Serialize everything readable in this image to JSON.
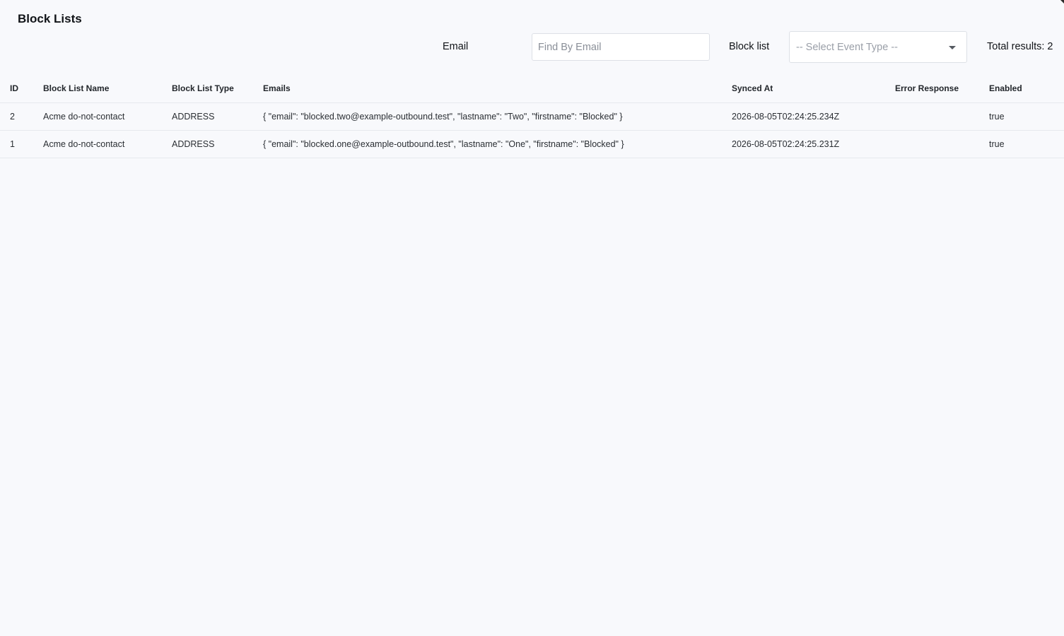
{
  "page": {
    "title": "Block Lists"
  },
  "filters": {
    "email_label": "Email",
    "email_placeholder": "Find By Email",
    "email_value": "",
    "blocklist_label": "Block list",
    "blocklist_selected": "-- Select Event Type --",
    "total_results": "Total results: 2"
  },
  "table": {
    "columns": {
      "id": "ID",
      "name": "Block List Name",
      "type": "Block List Type",
      "emails": "Emails",
      "synced_at": "Synced At",
      "error_response": "Error Response",
      "enabled": "Enabled"
    },
    "rows": [
      {
        "id": "2",
        "name": "Acme do-not-contact",
        "type": "ADDRESS",
        "emails": "{ \"email\": \"blocked.two@example-outbound.test\", \"lastname\": \"Two\", \"firstname\": \"Blocked\" }",
        "synced_at": "2026-08-05T02:24:25.234Z",
        "error_response": "",
        "enabled": "true"
      },
      {
        "id": "1",
        "name": "Acme do-not-contact",
        "type": "ADDRESS",
        "emails": "{ \"email\": \"blocked.one@example-outbound.test\", \"lastname\": \"One\", \"firstname\": \"Blocked\" }",
        "synced_at": "2026-08-05T02:24:25.231Z",
        "error_response": "",
        "enabled": "true"
      }
    ]
  }
}
